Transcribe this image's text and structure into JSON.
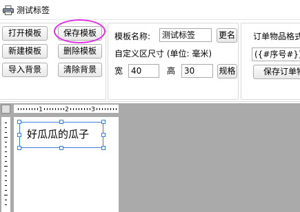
{
  "window": {
    "title": "测试标签"
  },
  "toolbar": {
    "open_template": "打开模板",
    "save_template": "保存模板",
    "new_template": "新建模板",
    "delete_template": "删除模板",
    "import_background": "导入背景",
    "clear_background": "清除背景"
  },
  "template": {
    "name_label": "模板名称:",
    "name_value": "测试标签",
    "rename_button": "更名",
    "size_caption": "自定义区尺寸 (单位: 毫米)",
    "width_label": "宽",
    "width_value": "40",
    "height_label": "高",
    "height_value": "30",
    "spec_button": "规格"
  },
  "order": {
    "format_label": "订单物品格式",
    "format_value": "({#序号#}){#",
    "save_button": "保存订单物"
  },
  "ruler": {
    "marks": [
      "1",
      "2",
      "3"
    ]
  },
  "canvas": {
    "text": "好瓜瓜的瓜子"
  },
  "colors": {
    "highlight": "#e22be6",
    "selection": "#3a7bd5",
    "workspace": "#aaaaaa"
  }
}
